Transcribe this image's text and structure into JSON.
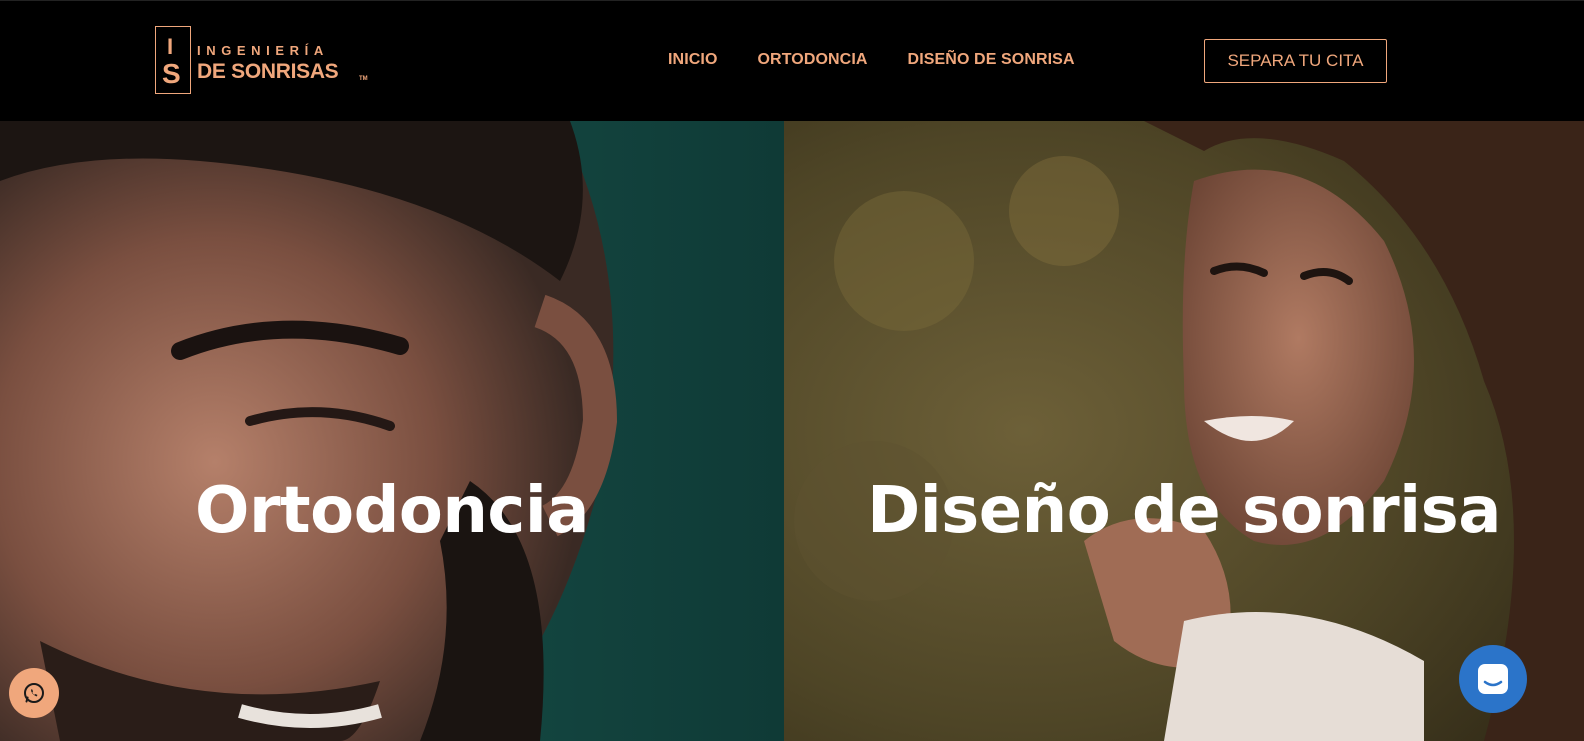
{
  "header": {
    "logo": {
      "mark_top": "I",
      "mark_bottom": "S",
      "line1": "INGENIERÍA",
      "line2": "DE SONRISAS",
      "trademark": "TM"
    },
    "nav": [
      {
        "label": "INICIO"
      },
      {
        "label": "ORTODONCIA"
      },
      {
        "label": "DISEÑO DE SONRISA"
      }
    ],
    "cta_label": "SEPARA TU CITA"
  },
  "panels": [
    {
      "title": "Ortodoncia",
      "image": "smiling-man-photo"
    },
    {
      "title": "Diseño de sonrisa",
      "image": "smiling-woman-photo"
    }
  ],
  "floating": {
    "whatsapp_icon": "whatsapp-icon",
    "chat_icon": "chat-bubble-icon"
  },
  "colors": {
    "brand": "#f0a77c",
    "header_bg": "#000000",
    "chat_blue": "#2b74c9",
    "title": "#ffffff"
  }
}
